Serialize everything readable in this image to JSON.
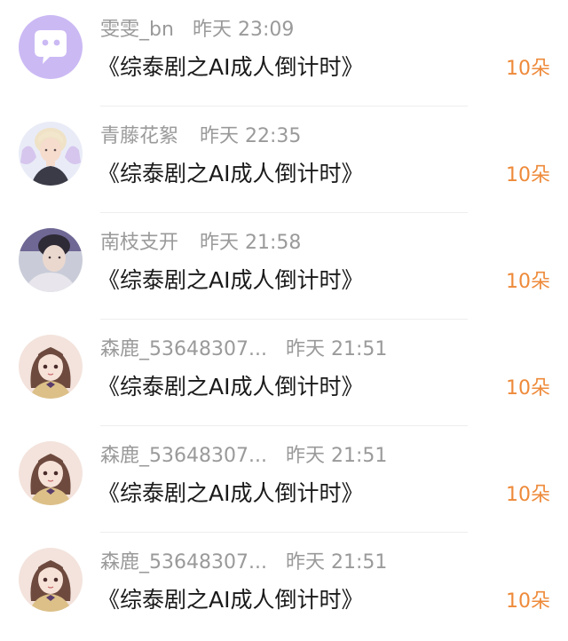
{
  "gifts": [
    {
      "user": "雯雯_bn",
      "time": "昨天 23:09",
      "title": "《综泰剧之AI成人倒计时》",
      "amount": "10朵",
      "avatar": "default-wechat-icon"
    },
    {
      "user": "青藤花絮",
      "time": "昨天 22:35",
      "title": "《综泰剧之AI成人倒计时》",
      "amount": "10朵",
      "avatar": "blonde-fairy-avatar"
    },
    {
      "user": "南枝支开",
      "time": "昨天 21:58",
      "title": "《综泰剧之AI成人倒计时》",
      "amount": "10朵",
      "avatar": "male-portrait-avatar"
    },
    {
      "user": "森鹿_53648307...",
      "time": "昨天 21:51",
      "title": "《综泰剧之AI成人倒计时》",
      "amount": "10朵",
      "avatar": "anime-girl-avatar"
    },
    {
      "user": "森鹿_53648307...",
      "time": "昨天 21:51",
      "title": "《综泰剧之AI成人倒计时》",
      "amount": "10朵",
      "avatar": "anime-girl-avatar"
    },
    {
      "user": "森鹿_53648307...",
      "time": "昨天 21:51",
      "title": "《综泰剧之AI成人倒计时》",
      "amount": "10朵",
      "avatar": "anime-girl-avatar"
    }
  ],
  "colors": {
    "accent": "#ee8a3a",
    "meta": "#9a9a9a",
    "title": "#1a1a1a"
  }
}
